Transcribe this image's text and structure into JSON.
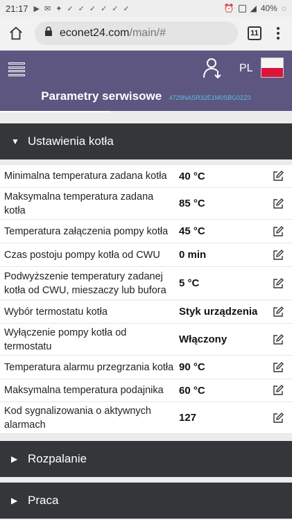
{
  "statusbar": {
    "time": "21:17",
    "battery": "40%"
  },
  "browser": {
    "url_host": "econet24.com",
    "url_path": "/main/#",
    "tab_count": "11"
  },
  "header": {
    "language": "PL",
    "title": "Parametry serwisowe",
    "device_id": "4729NASR32E1M0SBG02Z0"
  },
  "sections": [
    {
      "label": "Ustawienia kotła",
      "expanded": true
    },
    {
      "label": "Rozpalanie",
      "expanded": false
    },
    {
      "label": "Praca",
      "expanded": false
    }
  ],
  "params": [
    {
      "label": "Minimalna temperatura zadana kotła",
      "value": "40 °C"
    },
    {
      "label": "Maksymalna temperatura zadana kotła",
      "value": "85 °C"
    },
    {
      "label": "Temperatura załączenia pompy kotła",
      "value": "45 °C"
    },
    {
      "label": "Czas postoju pompy kotła od CWU",
      "value": "0 min"
    },
    {
      "label": "Podwyższenie temperatury zadanej kotła od CWU, mieszaczy lub bufora",
      "value": "5 °C"
    },
    {
      "label": "Wybór termostatu kotła",
      "value": "Styk urządzenia"
    },
    {
      "label": "Wyłączenie pompy kotła od termostatu",
      "value": "Włączony"
    },
    {
      "label": "Temperatura alarmu przegrzania kotła",
      "value": "90 °C"
    },
    {
      "label": "Maksymalna temperatura podajnika",
      "value": "60 °C"
    },
    {
      "label": "Kod sygnalizowania o aktywnych alarmach",
      "value": "127"
    }
  ]
}
